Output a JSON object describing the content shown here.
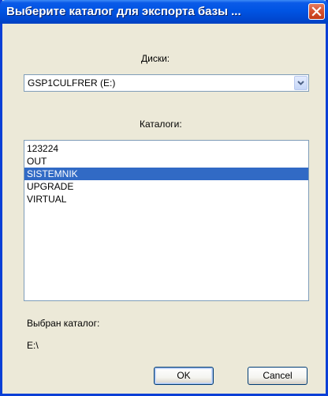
{
  "window": {
    "title": "Выберите каталог для экспорта базы ..."
  },
  "drives": {
    "label": "Диски:",
    "selected": "GSP1CULFRER  (E:)"
  },
  "directories": {
    "label": "Каталоги:",
    "items": [
      "123224",
      "OUT",
      "SISTEMNIK",
      "UPGRADE",
      "VIRTUAL"
    ],
    "selected_item": "SISTEMNIK"
  },
  "selection": {
    "label": "Выбран каталог:",
    "path": "E:\\"
  },
  "buttons": {
    "ok": "OK",
    "cancel": "Cancel"
  },
  "colors": {
    "titlebar": "#0054e3",
    "selection": "#316ac5",
    "dialog_bg": "#ece9d8"
  },
  "icons": {
    "close": "close-icon",
    "dropdown": "chevron-down-icon"
  }
}
